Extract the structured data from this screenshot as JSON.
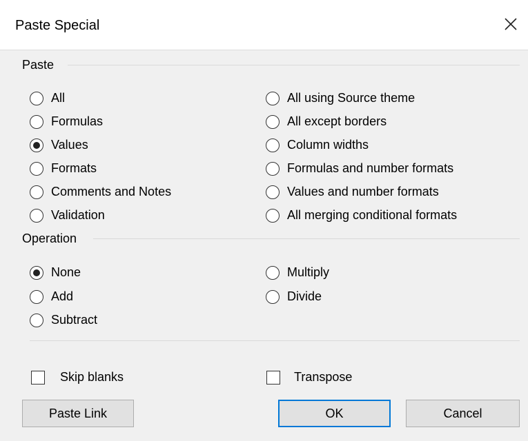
{
  "dialog": {
    "title": "Paste Special"
  },
  "paste": {
    "label": "Paste",
    "left": [
      {
        "label": "All",
        "checked": false
      },
      {
        "label": "Formulas",
        "checked": false
      },
      {
        "label": "Values",
        "checked": true
      },
      {
        "label": "Formats",
        "checked": false
      },
      {
        "label": "Comments and Notes",
        "checked": false
      },
      {
        "label": "Validation",
        "checked": false
      }
    ],
    "right": [
      {
        "label": "All using Source theme",
        "checked": false
      },
      {
        "label": "All except borders",
        "checked": false
      },
      {
        "label": "Column widths",
        "checked": false
      },
      {
        "label": "Formulas and number formats",
        "checked": false
      },
      {
        "label": "Values and number formats",
        "checked": false
      },
      {
        "label": "All merging conditional formats",
        "checked": false
      }
    ]
  },
  "operation": {
    "label": "Operation",
    "left": [
      {
        "label": "None",
        "checked": true
      },
      {
        "label": "Add",
        "checked": false
      },
      {
        "label": "Subtract",
        "checked": false
      }
    ],
    "right": [
      {
        "label": "Multiply",
        "checked": false
      },
      {
        "label": "Divide",
        "checked": false
      }
    ]
  },
  "checkboxes": {
    "skip_blanks": {
      "label": "Skip blanks",
      "checked": false
    },
    "transpose": {
      "label": "Transpose",
      "checked": false
    }
  },
  "buttons": {
    "paste_link": "Paste Link",
    "ok": "OK",
    "cancel": "Cancel"
  },
  "colors": {
    "focus_border": "#0078d7",
    "background": "#f0f0f0"
  }
}
